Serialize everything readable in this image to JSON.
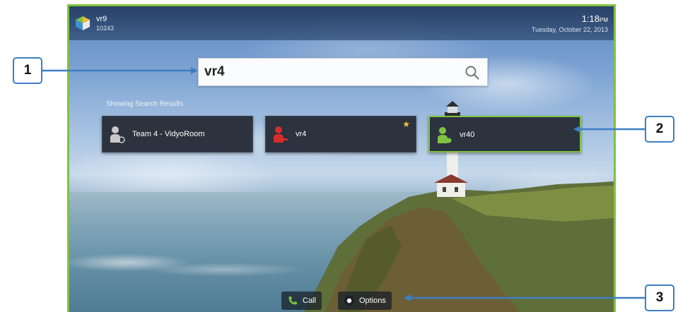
{
  "header": {
    "user_name": "vr9",
    "user_extension": "10243",
    "time": "1:18",
    "ampm": "PM",
    "date": "Tuesday, October 22, 2013"
  },
  "search": {
    "value": "vr4"
  },
  "results": {
    "label": "Showing Search Results",
    "items": [
      {
        "name": "Team 4 - VidyoRoom",
        "status": "offline",
        "favorite": false
      },
      {
        "name": "vr4",
        "status": "busy",
        "favorite": true,
        "star": "★"
      },
      {
        "name": "vr40",
        "status": "available",
        "favorite": false,
        "selected": true
      }
    ]
  },
  "actions": {
    "call_label": "Call",
    "options_label": "Options"
  },
  "callouts": [
    "1",
    "2",
    "3"
  ],
  "colors": {
    "frame": "#7ec242",
    "callout": "#3e7fc2",
    "status_offline": "#c9c9c9",
    "status_busy": "#d62c2c",
    "status_available": "#7ec242",
    "favorite_star": "#f2c53b"
  }
}
